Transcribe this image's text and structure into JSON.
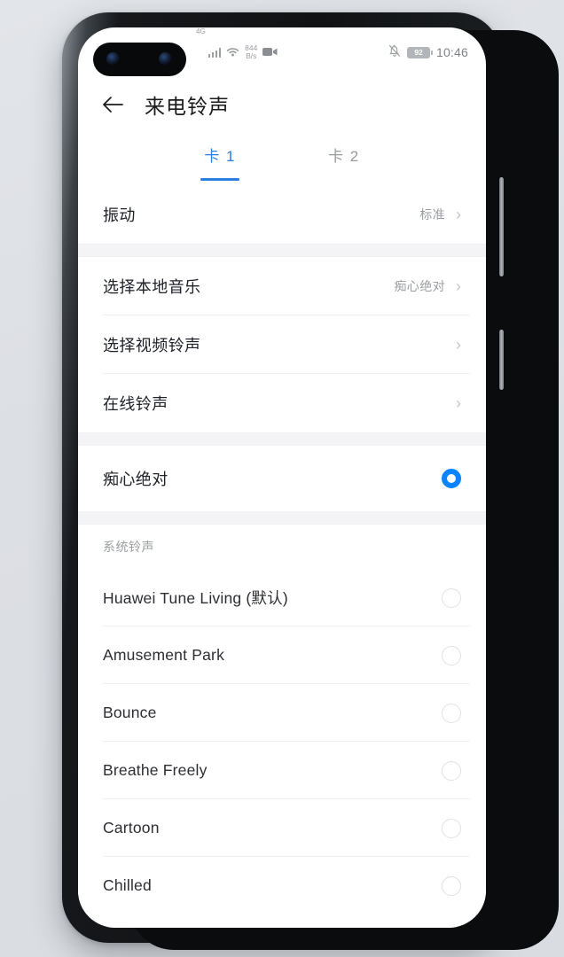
{
  "status_bar": {
    "network_label": "4G",
    "signal_icon": "signal-bars-icon",
    "wifi_icon": "wifi-icon",
    "speed_value": "844",
    "speed_unit": "B/s",
    "recording_icon": "video-recording-icon",
    "mute_icon": "bell-muted-icon",
    "battery_level": "92",
    "time": "10:46"
  },
  "title_bar": {
    "back_icon": "back-arrow-icon",
    "title": "来电铃声"
  },
  "tabs": [
    {
      "label": "卡 1",
      "active": true
    },
    {
      "label": "卡 2",
      "active": false
    }
  ],
  "settings_section": [
    {
      "label": "振动",
      "value": "标准",
      "chevron": "›"
    }
  ],
  "source_section": [
    {
      "label": "选择本地音乐",
      "value": "痴心绝对",
      "chevron": "›"
    },
    {
      "label": "选择视频铃声",
      "value": "",
      "chevron": "›"
    },
    {
      "label": "在线铃声",
      "value": "",
      "chevron": "›"
    }
  ],
  "current_tone": {
    "label": "痴心绝对",
    "selected": true
  },
  "system_section": {
    "header": "系统铃声",
    "items": [
      {
        "label": "Huawei Tune Living (默认)",
        "selected": false
      },
      {
        "label": "Amusement Park",
        "selected": false
      },
      {
        "label": "Bounce",
        "selected": false
      },
      {
        "label": "Breathe Freely",
        "selected": false
      },
      {
        "label": "Cartoon",
        "selected": false
      },
      {
        "label": "Chilled",
        "selected": false
      }
    ]
  },
  "colors": {
    "accent": "#0a84ff",
    "tab_active": "#2a7de1",
    "background": "#ffffff",
    "gap": "#f4f4f6",
    "secondary_text": "#9a9da1"
  }
}
